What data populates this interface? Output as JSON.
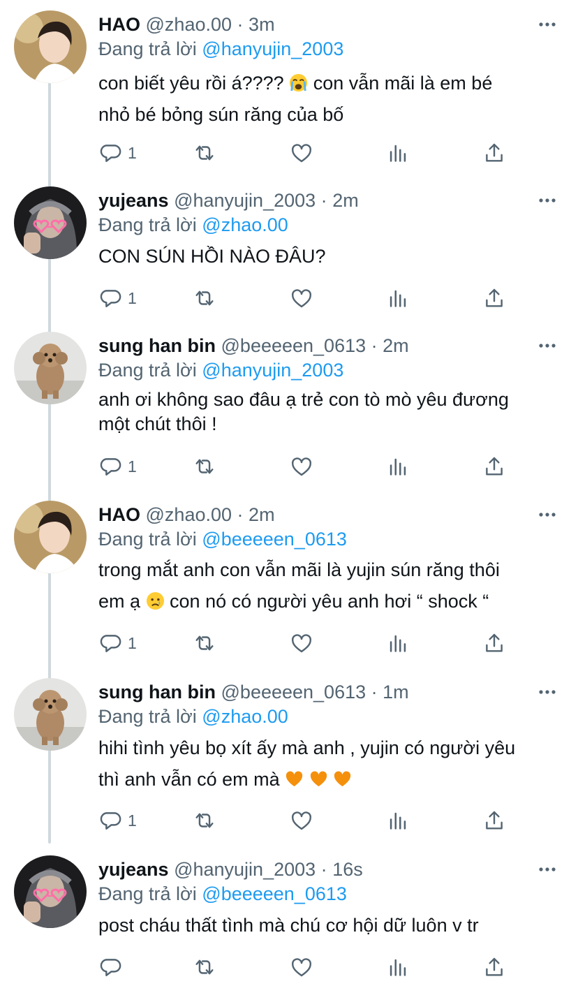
{
  "labels": {
    "replying_to": "Đang trả lời"
  },
  "tweets": [
    {
      "name": "HAO",
      "handle": "@zhao.00",
      "dot": "·",
      "time": "3m",
      "reply_to": "@hanyujin_2003",
      "lines": [
        "con biết yêu rồi á???? ",
        " con vẫn mãi là em bé",
        "nhỏ bé bỏng sún răng của bố"
      ],
      "emoji": [
        "loudly-crying-face"
      ],
      "reply_count": "1",
      "avatar": "boy-portrait"
    },
    {
      "name": "yujeans",
      "handle": "@hanyujin_2003",
      "dot": "·",
      "time": "2m",
      "reply_to": "@zhao.00",
      "lines": [
        "CON SÚN HỒI NÀO ĐÂU?"
      ],
      "reply_count": "1",
      "avatar": "hooded-selfie"
    },
    {
      "name": "sung han bin",
      "handle": "@beeeeen_0613",
      "dot": "·",
      "time": "2m",
      "reply_to": "@hanyujin_2003",
      "lines": [
        "anh ơi không sao đâu ạ trẻ con tò mò yêu đương",
        "một chút thôi !"
      ],
      "reply_count": "1",
      "avatar": "poodle-dog"
    },
    {
      "name": "HAO",
      "handle": "@zhao.00",
      "dot": "·",
      "time": "2m",
      "reply_to": "@beeeeen_0613",
      "lines": [
        "trong mắt anh con vẫn mãi là yujin sún răng thôi",
        "em ạ ",
        " con nó có người yêu anh hơi “ shock “"
      ],
      "emoji": [
        "crying-face"
      ],
      "reply_count": "1",
      "avatar": "boy-portrait"
    },
    {
      "name": "sung han bin",
      "handle": "@beeeeen_0613",
      "dot": "·",
      "time": "1m",
      "reply_to": "@zhao.00",
      "lines": [
        "hihi tình yêu bọ xít ấy mà anh , yujin có người yêu",
        "thì anh vẫn có em mà "
      ],
      "emoji": [
        "orange-heart",
        "orange-heart",
        "orange-heart"
      ],
      "reply_count": "1",
      "avatar": "poodle-dog"
    },
    {
      "name": "yujeans",
      "handle": "@hanyujin_2003",
      "dot": "·",
      "time": "16s",
      "reply_to": "@beeeeen_0613",
      "lines": [
        "post cháu thất tình mà chú cơ hội dữ luôn v tr"
      ],
      "reply_count": "",
      "avatar": "hooded-selfie"
    }
  ],
  "icons": {
    "reply": "speech-bubble-icon",
    "retweet": "retweet-icon",
    "like": "heart-icon",
    "analytics": "bar-chart-icon",
    "share": "share-upload-icon",
    "more": "more-dots-icon"
  },
  "colors": {
    "link": "#1d9bf0",
    "secondary": "#536471",
    "thread_line": "#cfd9de"
  }
}
